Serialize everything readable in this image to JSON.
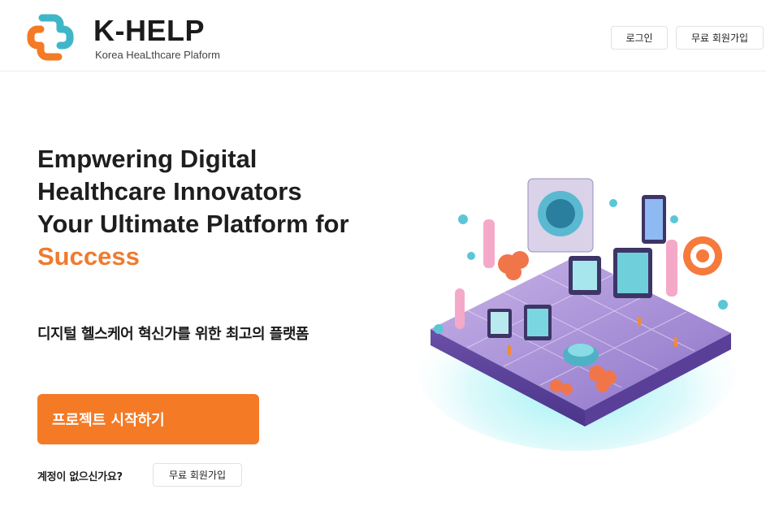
{
  "brand": {
    "name": "K-HELP",
    "tagline": "Korea HeaLthcare Plaform",
    "colors": {
      "orange": "#F47A25",
      "teal": "#3FB6C8",
      "text": "#1E1E1E"
    }
  },
  "header": {
    "login_label": "로그인",
    "signup_label": "무료 회원가입"
  },
  "hero": {
    "title_lines": [
      "Empwering Digital",
      "Healthcare Innovators",
      "Your Ultimate Platform for"
    ],
    "title_accent": "Success",
    "subtitle": "디지털 헬스케어 혁신가를 위한 최고의 플랫폼",
    "cta_label": "프로젝트 시작하기",
    "no_account_text": "계정이 없으신가요?",
    "no_account_signup_label": "무료 회원가입"
  },
  "illustration": {
    "icon": "isometric-digital-health-city-icon"
  }
}
